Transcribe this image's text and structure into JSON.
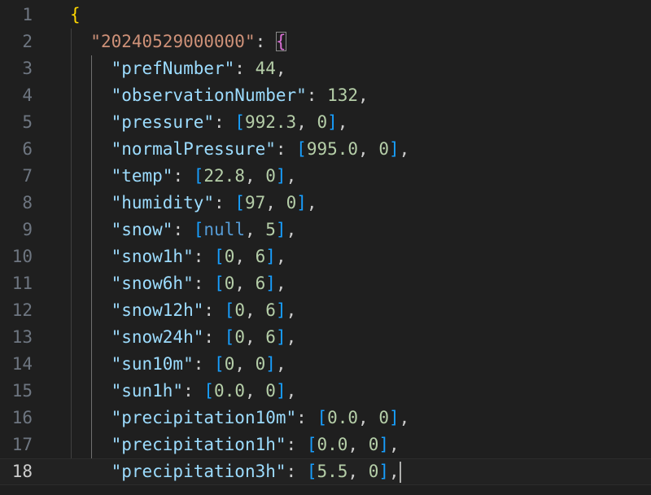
{
  "editor": {
    "current_line": 18,
    "line_numbers": [
      "1",
      "2",
      "3",
      "4",
      "5",
      "6",
      "7",
      "8",
      "9",
      "10",
      "11",
      "12",
      "13",
      "14",
      "15",
      "16",
      "17",
      "18"
    ],
    "root_open": "{",
    "object_key": "\"20240529000000\"",
    "object_open": "{",
    "entries": [
      {
        "key": "\"prefNumber\"",
        "value": "44"
      },
      {
        "key": "\"observationNumber\"",
        "value": "132"
      },
      {
        "key": "\"pressure\"",
        "items": [
          "992.3",
          "0"
        ]
      },
      {
        "key": "\"normalPressure\"",
        "items": [
          "995.0",
          "0"
        ]
      },
      {
        "key": "\"temp\"",
        "items": [
          "22.8",
          "0"
        ]
      },
      {
        "key": "\"humidity\"",
        "items": [
          "97",
          "0"
        ]
      },
      {
        "key": "\"snow\"",
        "items": [
          "null",
          "5"
        ]
      },
      {
        "key": "\"snow1h\"",
        "items": [
          "0",
          "6"
        ]
      },
      {
        "key": "\"snow6h\"",
        "items": [
          "0",
          "6"
        ]
      },
      {
        "key": "\"snow12h\"",
        "items": [
          "0",
          "6"
        ]
      },
      {
        "key": "\"snow24h\"",
        "items": [
          "0",
          "6"
        ]
      },
      {
        "key": "\"sun10m\"",
        "items": [
          "0",
          "0"
        ]
      },
      {
        "key": "\"sun1h\"",
        "items": [
          "0.0",
          "0"
        ]
      },
      {
        "key": "\"precipitation10m\"",
        "items": [
          "0.0",
          "0"
        ]
      },
      {
        "key": "\"precipitation1h\"",
        "items": [
          "0.0",
          "0"
        ]
      },
      {
        "key": "\"precipitation3h\"",
        "items": [
          "5.5",
          "0"
        ]
      }
    ]
  },
  "colors": {
    "background": "#1f1f1f",
    "key": "#9cdcfe",
    "string": "#ce9178",
    "number": "#b5cea8",
    "keyword": "#569cd6",
    "bracket_level1": "#ffd700",
    "bracket_level2": "#da70d6",
    "bracket_level3": "#179fff"
  }
}
